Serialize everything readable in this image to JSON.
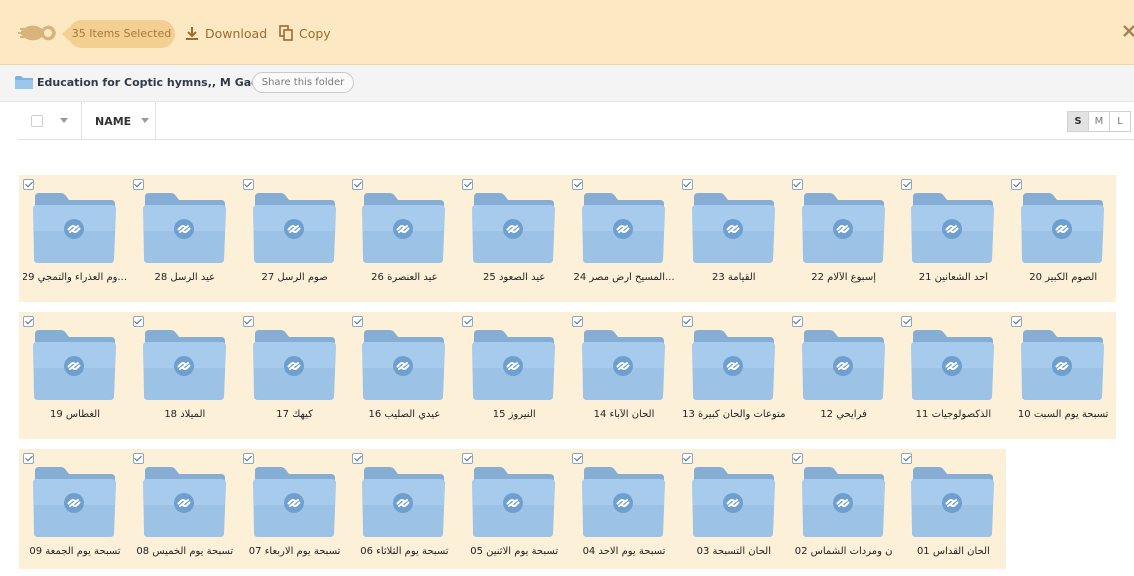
{
  "topbar": {
    "selected_label": "35 Items Selected",
    "download_label": "Download",
    "copy_label": "Copy"
  },
  "breadcrumb": {
    "folder_title": "Education for Coptic hymns,, M Gad",
    "share_label": "Share this folder"
  },
  "header": {
    "name_label": "NAME",
    "sizes": [
      "S",
      "M",
      "L"
    ],
    "active_size": "S"
  },
  "colors": {
    "topbar_bg": "#fce9c4",
    "selected_row_bg": "#fdf0d9",
    "folder_blue": "#9cc3e6",
    "accent_text": "#9d6a2f"
  },
  "rows": [
    {
      "items": [
        "...وم العذراء والتمجي 29",
        "عيد الرسل 28",
        "صوم الرسل 27",
        "عيد العنصرة 26",
        "عيد الصعود 25",
        "...المسيح أرض مصر 24",
        "القيامة 23",
        "إسبوع الآلام 22",
        "أحد الشعانين 21",
        "الصوم الكبير 20"
      ]
    },
    {
      "items": [
        "الغطاس 19",
        "الميلاد 18",
        "كيهك 17",
        "عيدي الصليب 16",
        "النيروز 15",
        "ألحان الآباء 14",
        "متوعات وألحان كبيرة 13",
        "فرايحي 12",
        "الذكصولوجيات 11",
        "تسبحة يوم السبت 10"
      ]
    },
    {
      "items": [
        "تسبحة يوم الجمعة 09",
        "تسبحة يوم الخميس 08",
        "تسبحة يوم الاربعاء 07",
        "تسبحة يوم الثلاثاء 06",
        "تسبحة يوم الاثنين 05",
        "تسبحة يوم الاحد 04",
        "ألحان التسبحة 03",
        "ن ومردات الشماس 02",
        "الحان القداس 01"
      ]
    }
  ]
}
